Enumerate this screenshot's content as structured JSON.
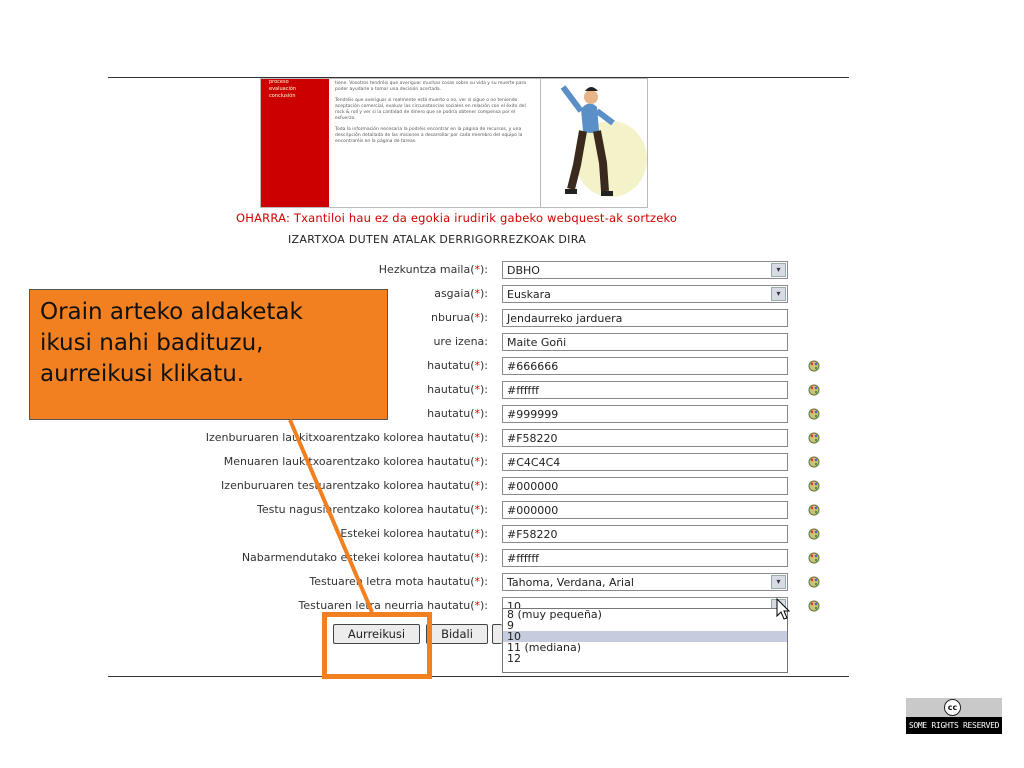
{
  "preview": {
    "sidebar_items": [
      "proceso",
      "evaluación",
      "conclusión"
    ],
    "paragraphs": [
      "tiene. Vosotros tendréis que averiguar muchas cosas sobre su vida y su muerte para poder ayudarle a tomar una decisión acertada.",
      "Tendréis que averiguar si realmente está muerto o no, ver si sigue o no teniendo aceptación comercial, evaluar las circunstancias sociales en relación con el éxito del rock & roll y ver si la cantidad de dinero que se podría obtener compensa por el esfuerzo.",
      "Toda la información necesaria la podréis encontrar en la página de recursos, y una descripción detallada de las misiones a desarrollar por cada miembro del equipo la encontraréis en la página de tareas."
    ]
  },
  "note": "OHARRA: Txantiloi hau ez da egokia irudirik gabeko webquest-ak sortzeko",
  "required_notice": "IZARTXOA DUTEN ATALAK DERRIGORREZKOAK DIRA",
  "fields": [
    {
      "label": "Hezkuntza maila(",
      "star": "*",
      "suffix": "):",
      "value": "DBHO",
      "type": "select"
    },
    {
      "label": "asgaia(",
      "star": "*",
      "suffix": "):",
      "value": "Euskara",
      "type": "select"
    },
    {
      "label": "nburua(",
      "star": "*",
      "suffix": "):",
      "value": "Jendaurreko jarduera",
      "type": "text"
    },
    {
      "label": "ure izena:",
      "star": "",
      "suffix": "",
      "value": "Maite Goñi",
      "type": "text"
    },
    {
      "label": "hautatu(",
      "star": "*",
      "suffix": "):",
      "value": "#666666",
      "type": "color"
    },
    {
      "label": "hautatu(",
      "star": "*",
      "suffix": "):",
      "value": "#ffffff",
      "type": "color"
    },
    {
      "label": "hautatu(",
      "star": "*",
      "suffix": "):",
      "value": "#999999",
      "type": "color"
    },
    {
      "label": "Izenburuaren laukitxoarentzako kolorea hautatu(",
      "star": "*",
      "suffix": "):",
      "value": "#F58220",
      "type": "color"
    },
    {
      "label": "Menuaren laukitxoarentzako kolorea hautatu(",
      "star": "*",
      "suffix": "):",
      "value": "#C4C4C4",
      "type": "color"
    },
    {
      "label": "Izenburuaren testuarentzako kolorea hautatu(",
      "star": "*",
      "suffix": "):",
      "value": "#000000",
      "type": "color"
    },
    {
      "label": "Testu nagusiarentzako kolorea hautatu(",
      "star": "*",
      "suffix": "):",
      "value": "#000000",
      "type": "color"
    },
    {
      "label": "Estekei kolorea hautatu(",
      "star": "*",
      "suffix": "):",
      "value": "#F58220",
      "type": "color"
    },
    {
      "label": "Nabarmendutako estekei kolorea hautatu(",
      "star": "*",
      "suffix": "):",
      "value": "#ffffff",
      "type": "color"
    },
    {
      "label": "Testuaren letra mota hautatu(",
      "star": "*",
      "suffix": "):",
      "value": "Tahoma, Verdana, Arial",
      "type": "select-color"
    },
    {
      "label": "Testuaren letra neurria hautatu(",
      "star": "*",
      "suffix": "):",
      "value": "10",
      "type": "select-color"
    }
  ],
  "size_options": [
    "8 (muy pequeña)",
    "9",
    "10",
    "11 (mediana)",
    "12"
  ],
  "size_selected": "10",
  "buttons": {
    "preview": "Aurreikusi",
    "send": "Bidali"
  },
  "callout": {
    "lines": [
      "Orain arteko aldaketak",
      "ikusi nahi badituzu,",
      "aurreikusi klikatu."
    ]
  },
  "license": {
    "logo": "cc",
    "text": "SOME RIGHTS RESERVED"
  },
  "colors": {
    "accent": "#f28021",
    "note_red": "#d10000",
    "preview_red": "#cc0000"
  }
}
